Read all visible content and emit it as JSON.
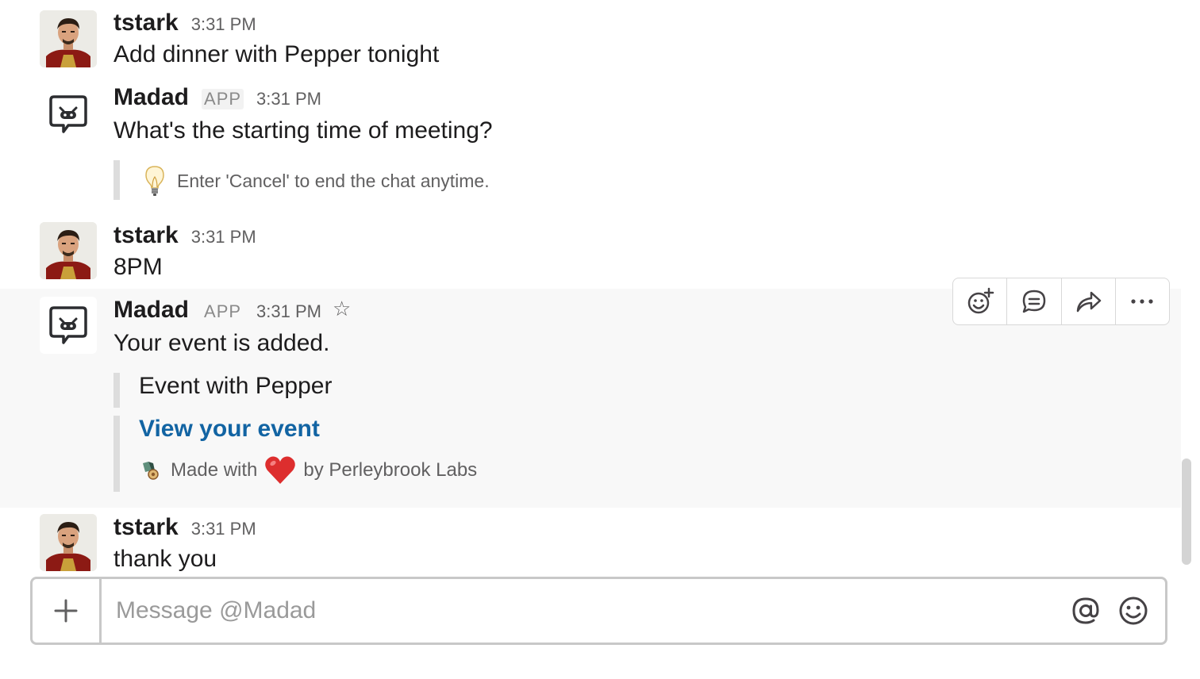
{
  "messages": [
    {
      "author": "tstark",
      "time": "3:31 PM",
      "text": "Add dinner with Pepper tonight"
    },
    {
      "author": "Madad",
      "badge": "APP",
      "time": "3:31 PM",
      "text": "What's the starting time of meeting?",
      "hint": "Enter 'Cancel' to end the chat anytime."
    },
    {
      "author": "tstark",
      "time": "3:31 PM",
      "text": "8PM"
    },
    {
      "author": "Madad",
      "badge": "APP",
      "time": "3:31 PM",
      "text": "Your event is added.",
      "attachment_title": "Event with Pepper",
      "link_text": "View your event",
      "footer_prefix": "Made with",
      "footer_suffix": "by Perleybrook Labs"
    },
    {
      "author": "tstark",
      "time": "3:31 PM",
      "text": "thank you"
    }
  ],
  "icons": {
    "star": "star-icon",
    "hint": "lightbulb-icon",
    "heart": "heart-icon",
    "actions": [
      "add-reaction-icon",
      "start-thread-icon",
      "share-message-icon",
      "more-actions-icon"
    ],
    "composer": [
      "plus-icon",
      "mention-icon",
      "emoji-icon"
    ]
  },
  "composer": {
    "placeholder": "Message @Madad"
  },
  "colors": {
    "link": "#1264a3",
    "hover_bg": "#f8f8f8",
    "quote_bar": "#dddddd"
  }
}
